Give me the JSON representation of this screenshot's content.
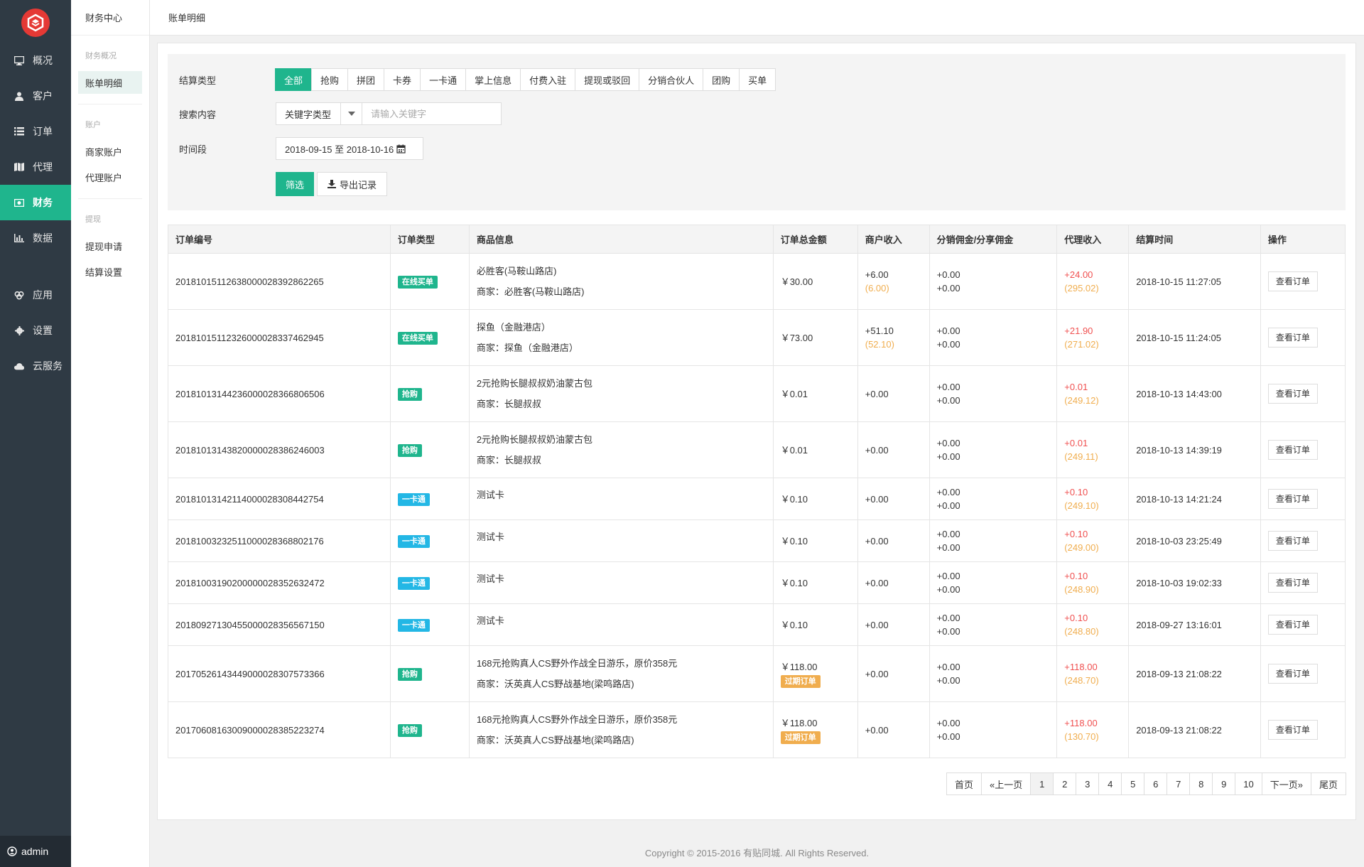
{
  "nav": {
    "items": [
      {
        "label": "概况",
        "icon": "monitor-icon"
      },
      {
        "label": "客户",
        "icon": "user-icon"
      },
      {
        "label": "订单",
        "icon": "list-icon"
      },
      {
        "label": "代理",
        "icon": "map-icon"
      },
      {
        "label": "财务",
        "icon": "money-icon"
      },
      {
        "label": "数据",
        "icon": "bar-chart-icon"
      }
    ],
    "items2": [
      {
        "label": "应用",
        "icon": "apps-icon"
      },
      {
        "label": "设置",
        "icon": "gear-icon"
      },
      {
        "label": "云服务",
        "icon": "cloud-icon"
      }
    ],
    "admin": "admin"
  },
  "subnav": {
    "title": "财务中心",
    "group1": {
      "head": "财务概况",
      "items": [
        "账单明细"
      ]
    },
    "group2": {
      "head": "账户",
      "items": [
        "商家账户",
        "代理账户"
      ]
    },
    "group3": {
      "head": "提现",
      "items": [
        "提现申请",
        "结算设置"
      ]
    }
  },
  "topbar": {
    "breadcrumb": "账单明细"
  },
  "filter": {
    "type_label": "结算类型",
    "types": [
      "全部",
      "抢购",
      "拼团",
      "卡券",
      "一卡通",
      "掌上信息",
      "付费入驻",
      "提现或驳回",
      "分销合伙人",
      "团购",
      "买单"
    ],
    "search_label": "搜索内容",
    "keyword_type": "关键字类型",
    "keyword_placeholder": "请输入关键字",
    "period_label": "时间段",
    "date_range": "2018-09-15 至 2018-10-16",
    "filter_btn": "筛选",
    "export_btn": "导出记录"
  },
  "table": {
    "headers": [
      "订单编号",
      "订单类型",
      "商品信息",
      "订单总金额",
      "商户收入",
      "分销佣金/分享佣金",
      "代理收入",
      "结算时间",
      "操作"
    ],
    "action_label": "查看订单",
    "rows": [
      {
        "id": "201810151126380000283928622​65",
        "type": "在线买单",
        "tag": "online",
        "goods": "必胜客(马鞍山路店)",
        "merchant": "商家：必胜客(马鞍山路店)",
        "total": "￥30.00",
        "expired": "",
        "m_income": "+6.00",
        "m_sub": "(6.00)",
        "dist1": "+0.00",
        "dist2": "+0.00",
        "agent": "+24.00",
        "agent_sub": "(295.02)",
        "time": "2018-10-15 11:27:05"
      },
      {
        "id": "20181015112326000028337462945",
        "type": "在线买单",
        "tag": "online",
        "goods": "探鱼（金融港店）",
        "merchant": "商家：探鱼（金融港店）",
        "total": "￥73.00",
        "expired": "",
        "m_income": "+51.10",
        "m_sub": "(52.10)",
        "dist1": "+0.00",
        "dist2": "+0.00",
        "agent": "+21.90",
        "agent_sub": "(271.02)",
        "time": "2018-10-15 11:24:05"
      },
      {
        "id": "20181013144236000028366806506",
        "type": "抢购",
        "tag": "qiang",
        "goods": "2元抢购长腿叔叔奶油蒙古包",
        "merchant": "商家：长腿叔叔",
        "total": "￥0.01",
        "expired": "",
        "m_income": "+0.00",
        "m_sub": "",
        "dist1": "+0.00",
        "dist2": "+0.00",
        "agent": "+0.01",
        "agent_sub": "(249.12)",
        "time": "2018-10-13 14:43:00"
      },
      {
        "id": "20181013143820000028386246003",
        "type": "抢购",
        "tag": "qiang",
        "goods": "2元抢购长腿叔叔奶油蒙古包",
        "merchant": "商家：长腿叔叔",
        "total": "￥0.01",
        "expired": "",
        "m_income": "+0.00",
        "m_sub": "",
        "dist1": "+0.00",
        "dist2": "+0.00",
        "agent": "+0.01",
        "agent_sub": "(249.11)",
        "time": "2018-10-13 14:39:19"
      },
      {
        "id": "20181013142114000028308442754",
        "type": "一卡通",
        "tag": "card",
        "goods": "测试卡",
        "merchant": "",
        "total": "￥0.10",
        "expired": "",
        "m_income": "+0.00",
        "m_sub": "",
        "dist1": "+0.00",
        "dist2": "+0.00",
        "agent": "+0.10",
        "agent_sub": "(249.10)",
        "time": "2018-10-13 14:21:24"
      },
      {
        "id": "20181003232511000028368802176",
        "type": "一卡通",
        "tag": "card",
        "goods": "测试卡",
        "merchant": "",
        "total": "￥0.10",
        "expired": "",
        "m_income": "+0.00",
        "m_sub": "",
        "dist1": "+0.00",
        "dist2": "+0.00",
        "agent": "+0.10",
        "agent_sub": "(249.00)",
        "time": "2018-10-03 23:25:49"
      },
      {
        "id": "20181003190200000028352632472",
        "type": "一卡通",
        "tag": "card",
        "goods": "测试卡",
        "merchant": "",
        "total": "￥0.10",
        "expired": "",
        "m_income": "+0.00",
        "m_sub": "",
        "dist1": "+0.00",
        "dist2": "+0.00",
        "agent": "+0.10",
        "agent_sub": "(248.90)",
        "time": "2018-10-03 19:02:33"
      },
      {
        "id": "20180927130455000028356567150",
        "type": "一卡通",
        "tag": "card",
        "goods": "测试卡",
        "merchant": "",
        "total": "￥0.10",
        "expired": "",
        "m_income": "+0.00",
        "m_sub": "",
        "dist1": "+0.00",
        "dist2": "+0.00",
        "agent": "+0.10",
        "agent_sub": "(248.80)",
        "time": "2018-09-27 13:16:01"
      },
      {
        "id": "20170526143449000028307573366",
        "type": "抢购",
        "tag": "qiang",
        "goods": "168元抢购真人CS野外作战全日游乐，原价358元",
        "merchant": "商家：沃英真人CS野战基地(梁鸣路店)",
        "total": "￥118.00",
        "expired": "过期订单",
        "m_income": "+0.00",
        "m_sub": "",
        "dist1": "+0.00",
        "dist2": "+0.00",
        "agent": "+118.00",
        "agent_sub": "(248.70)",
        "time": "2018-09-13 21:08:22"
      },
      {
        "id": "20170608163009000028385223274",
        "type": "抢购",
        "tag": "qiang",
        "goods": "168元抢购真人CS野外作战全日游乐，原价358元",
        "merchant": "商家：沃英真人CS野战基地(梁鸣路店)",
        "total": "￥118.00",
        "expired": "过期订单",
        "m_income": "+0.00",
        "m_sub": "",
        "dist1": "+0.00",
        "dist2": "+0.00",
        "agent": "+118.00",
        "agent_sub": "(130.70)",
        "time": "2018-09-13 21:08:22"
      }
    ]
  },
  "pager": {
    "first": "首页",
    "prev": "«上一页",
    "pages": [
      "1",
      "2",
      "3",
      "4",
      "5",
      "6",
      "7",
      "8",
      "9",
      "10"
    ],
    "next": "下一页»",
    "last": "尾页"
  },
  "footer": "Copyright © 2015-2016 有贴同城. All Rights Reserved.",
  "colors": {
    "accent": "#1fb58d",
    "sidebar": "#2f3a44",
    "red": "#f05050",
    "orange": "#f0ad4e",
    "card": "#23b7e5"
  }
}
